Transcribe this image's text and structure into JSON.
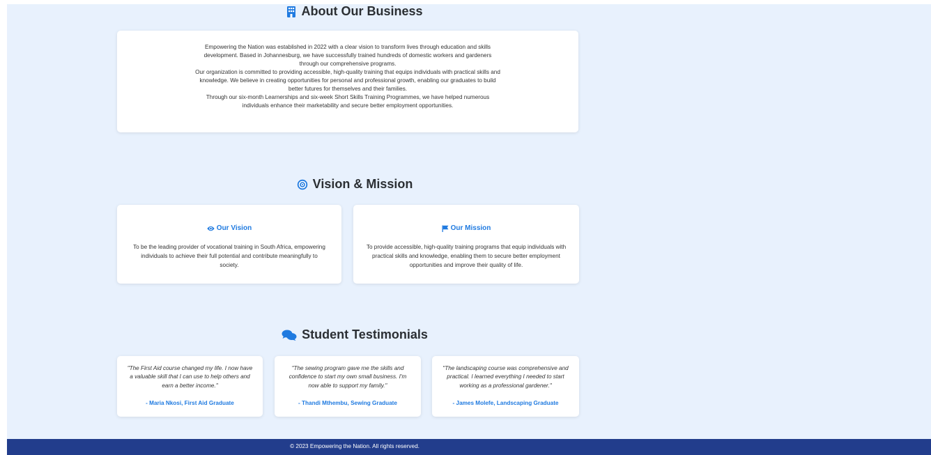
{
  "about": {
    "title": "About Our Business",
    "icon": "building-icon",
    "paragraphs": [
      "Empowering the Nation was established in 2022 with a clear vision to transform lives through education and skills development. Based in Johannesburg, we have successfully trained hundreds of domestic workers and gardeners through our comprehensive programs.",
      "Our organization is committed to providing accessible, high-quality training that equips individuals with practical skills and knowledge. We believe in creating opportunities for personal and professional growth, enabling our graduates to build better futures for themselves and their families.",
      "Through our six-month Learnerships and six-week Short Skills Training Programmes, we have helped numerous individuals enhance their marketability and secure better employment opportunities."
    ]
  },
  "vision_mission": {
    "title": "Vision & Mission",
    "icon": "bullseye-icon",
    "vision": {
      "heading": "Our Vision",
      "icon": "eye-icon",
      "text": "To be the leading provider of vocational training in South Africa, empowering individuals to achieve their full potential and contribute meaningfully to society."
    },
    "mission": {
      "heading": "Our Mission",
      "icon": "flag-icon",
      "text": "To provide accessible, high-quality training programs that equip individuals with practical skills and knowledge, enabling them to secure better employment opportunities and improve their quality of life."
    }
  },
  "testimonials": {
    "title": "Student Testimonials",
    "icon": "comments-icon",
    "items": [
      {
        "quote": "\"The First Aid course changed my life. I now have a valuable skill that I can use to help others and earn a better income.\"",
        "author": "- Maria Nkosi, First Aid Graduate"
      },
      {
        "quote": "\"The sewing program gave me the skills and confidence to start my own small business. I'm now able to support my family.\"",
        "author": "- Thandi Mthembu, Sewing Graduate"
      },
      {
        "quote": "\"The landscaping course was comprehensive and practical. I learned everything I needed to start working as a professional gardener.\"",
        "author": "- James Molefe, Landscaping Graduate"
      }
    ]
  },
  "footer": {
    "text": "© 2023 Empowering the Nation. All rights reserved."
  },
  "colors": {
    "accent": "#1f7ae0",
    "page_background": "#e8f1fd",
    "footer_background": "#223d8c"
  }
}
